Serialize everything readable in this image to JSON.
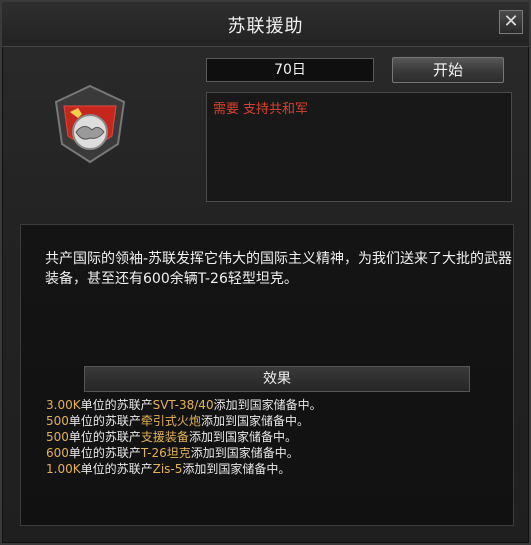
{
  "window": {
    "title": "苏联援助",
    "close_symbol": "✕"
  },
  "controls": {
    "days": "70日",
    "start_label": "开始"
  },
  "requirement": {
    "label": "需要",
    "value": "支持共和军"
  },
  "description": "共产国际的领袖-苏联发挥它伟大的国际主义精神，为我们送来了大批的武器装备，甚至还有600余辆T-26轻型坦克。",
  "effects": {
    "header": "效果",
    "rows": [
      {
        "amount": "3.00K",
        "mid": "单位的苏联产",
        "item": "SVT-38/40",
        "tail": "添加到国家储备中。"
      },
      {
        "amount": "500",
        "mid": "单位的苏联产",
        "item": "牵引式火炮",
        "tail": "添加到国家储备中。"
      },
      {
        "amount": "500",
        "mid": "单位的苏联产",
        "item": "支援装备",
        "tail": "添加到国家储备中。"
      },
      {
        "amount": "600",
        "mid": "单位的苏联产",
        "item": "T-26坦克",
        "tail": "添加到国家储备中。"
      },
      {
        "amount": "1.00K",
        "mid": "单位的苏联产",
        "item": "Zis-5",
        "tail": "添加到国家储备中。"
      }
    ]
  },
  "colors": {
    "highlight": "#e3b34a",
    "requirement": "#d9402f",
    "emblem_red": "#c7261d"
  },
  "icons": {
    "emblem": "soviet-handshake-emblem-icon"
  }
}
